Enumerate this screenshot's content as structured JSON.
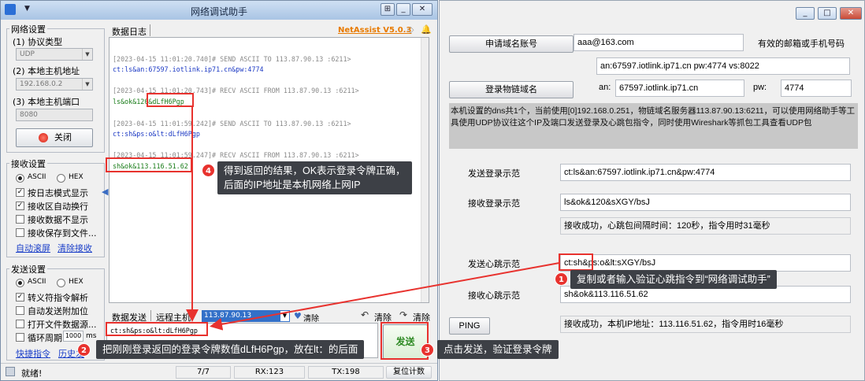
{
  "left_window": {
    "title": "网络调试助手",
    "network_settings": {
      "group_title": "网络设置",
      "protocol_label": "(1) 协议类型",
      "protocol_value": "UDP",
      "host_ip_label": "(2) 本地主机地址",
      "host_ip_value": "192.168.0.2",
      "port_label": "(3) 本地主机端口",
      "port_value": "8080",
      "close_button": "关闭"
    },
    "receive_settings": {
      "group_title": "接收设置",
      "ascii": "ASCII",
      "hex": "HEX",
      "options": [
        "按日志模式显示",
        "接收区自动换行",
        "接收数据不显示",
        "接收保存到文件..."
      ],
      "checked": [
        true,
        true,
        false,
        false
      ],
      "auto_clear": "自动滚屏",
      "clear_receive": "清除接收"
    },
    "send_settings": {
      "group_title": "发送设置",
      "ascii": "ASCII",
      "hex": "HEX",
      "options": [
        "转义符指令解析",
        "自动发送附加位",
        "打开文件数据源...",
        "循环周期"
      ],
      "checked": [
        true,
        false,
        false,
        false
      ],
      "period_value": "1000",
      "period_unit": "ms",
      "shortcut_link": "快捷指令",
      "history_link": "历史发"
    },
    "log_tab": "数据日志",
    "brand": "NetAssist V5.0.3",
    "log_lines": [
      {
        "text": "[2023-04-15 11:01:20.740]# SEND ASCII TO 113.87.90.13 :6211>",
        "style": "gry"
      },
      {
        "text": "ct:ls&an:67597.iotlink.ip71.cn&pw:4774",
        "style": "blu"
      },
      {
        "text": "[2023-04-15 11:01:20.743]# RECV ASCII FROM 113.87.90.13 :6211>",
        "style": "gry"
      },
      {
        "text": "ls&ok&120&dLfH6Pgp",
        "style": "grn"
      },
      {
        "text": "[2023-04-15 11:01:59.242]# SEND ASCII TO 113.87.90.13 :6211>",
        "style": "gry"
      },
      {
        "text": "ct:sh&ps:o&lt:dLfH6Pgp",
        "style": "blu"
      },
      {
        "text": "[2023-04-15 11:01:59.247]# RECV ASCII FROM 113.87.90.13 :6211>",
        "style": "gry"
      },
      {
        "text": "sh&ok&113.116.51.62",
        "style": "grn"
      }
    ],
    "send_area": {
      "tab_data": "数据发送",
      "tab_remote": "远程主机",
      "remote_value": "113.87.90.13",
      "clear_top": "清除",
      "clear_left": "清除",
      "clear_right": "清除",
      "send_text": "ct:sh&ps:o&lt:dLfH6Pgp",
      "send_button": "发送"
    },
    "status": {
      "ready": "就绪!",
      "count": "7/7",
      "rx": "RX:123",
      "tx": "TX:198",
      "reset": "复位计数"
    }
  },
  "right_window": {
    "apply_button": "申请域名账号",
    "email_value": "aaa@163.com",
    "email_hint": "有效的邮箱或手机号码",
    "account_info": "an:67597.iotlink.ip71.cn pw:4774 vs:8022",
    "login_button": "登录物链域名",
    "an_label": "an:",
    "an_value": "67597.iotlink.ip71.cn",
    "pw_label": "pw:",
    "pw_value": "4774",
    "note": "本机设置的dns共1个，当前使用[0]192.168.0.251，物链域名服务器113.87.90.13:6211，可以使用网络助手等工具使用UDP协议往这个IP及端口发送登录及心跳包指令，同时使用Wireshark等抓包工具查看UDP包",
    "send_login_label": "发送登录示范",
    "send_login_value": "ct:ls&an:67597.iotlink.ip71.cn&pw:4774",
    "recv_login_label": "接收登录示范",
    "recv_login_value": "ls&ok&120&sXGY/bsJ",
    "login_result": "接收成功，心跳包间隔时间：120秒，指令用时31毫秒",
    "send_heart_label": "发送心跳示范",
    "send_heart_value": "ct:sh&ps:o&lt:sXGY/bsJ",
    "recv_heart_label": "接收心跳示范",
    "recv_heart_value": "sh&ok&113.116.51.62",
    "ping_button": "PING",
    "heart_result": "接收成功，本机IP地址：113.116.51.62，指令用时16毫秒"
  },
  "annotations": [
    {
      "num": "1",
      "text": "复制或者输入验证心跳指令到“网络调试助手”"
    },
    {
      "num": "2",
      "text": "把刚刚登录返回的登录令牌数值dLfH6Pgp，放在lt：的后面"
    },
    {
      "num": "3",
      "text": "点击发送，验证登录令牌"
    },
    {
      "num": "4",
      "text": "得到返回的结果，OK表示登录令牌正确，",
      "text2": "后面的IP地址是本机网络上网IP"
    }
  ],
  "colors": {
    "annotation": "#e8322e",
    "callout_bg": "#3d4046",
    "brand": "#e87a00"
  }
}
